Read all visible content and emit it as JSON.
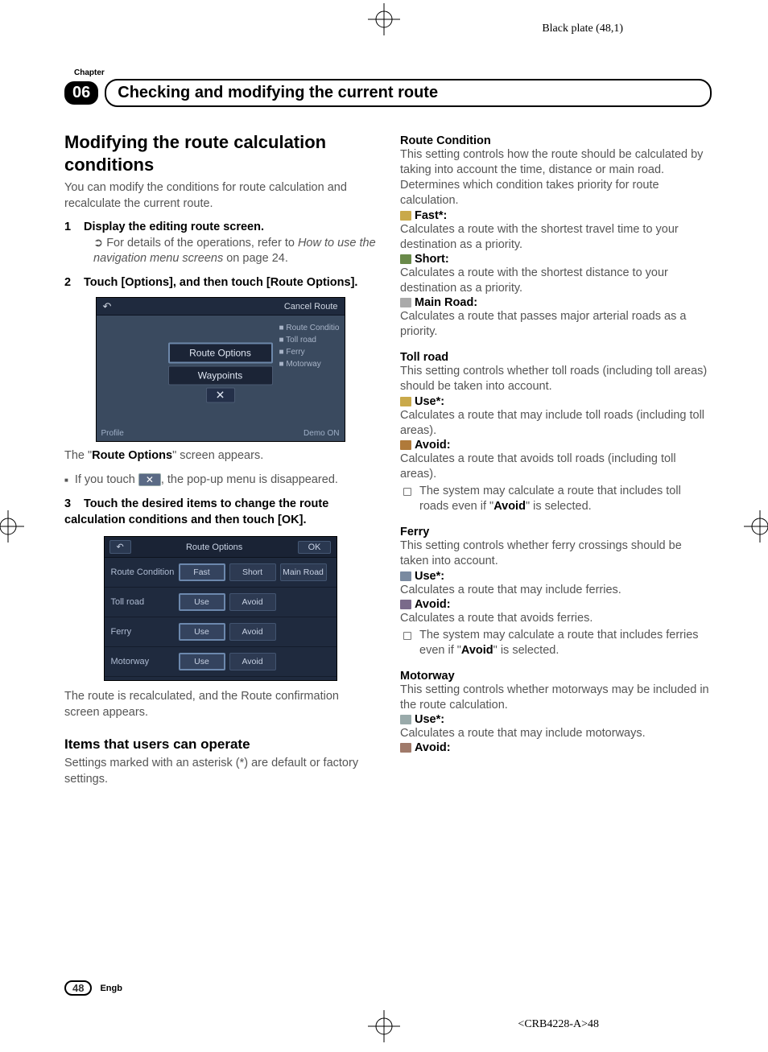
{
  "meta": {
    "black_plate": "Black plate (48,1)",
    "chapter_label": "Chapter",
    "chapter_number": "06",
    "header_title": "Checking and modifying the current route",
    "page_number": "48",
    "lang": "Engb",
    "doc_code": "<CRB4228-A>48"
  },
  "left": {
    "h1": "Modifying the route calculation conditions",
    "intro": "You can modify the conditions for route calculation and recalculate the current route.",
    "step1_num": "1",
    "step1": "Display the editing route screen.",
    "step1_note_pre": "For details of the operations, refer to ",
    "step1_note_ital": "How to use the navigation menu screens",
    "step1_note_post": " on page 24.",
    "step2_num": "2",
    "step2": "Touch [Options], and then touch [Route Options].",
    "shot1": {
      "cancel": "Cancel Route",
      "r1": "Route Conditio",
      "r2": "Toll road",
      "r3": "Ferry",
      "r4": "Motorway",
      "btn1": "Route Options",
      "btn2": "Waypoints",
      "profile": "Profile",
      "demo": "Demo ON"
    },
    "after_shot1_a": "The \"",
    "after_shot1_b": "Route Options",
    "after_shot1_c": "\" screen appears.",
    "bullet_pre": "If you touch ",
    "bullet_post": ", the pop-up menu is disappeared.",
    "step3_num": "3",
    "step3": "Touch the desired items to change the route calculation conditions and then touch [OK].",
    "shot2": {
      "title": "Route Options",
      "ok": "OK",
      "rows": [
        {
          "label": "Route Condition",
          "opts": [
            "Fast",
            "Short",
            "Main Road"
          ],
          "sel": 0
        },
        {
          "label": "Toll road",
          "opts": [
            "Use",
            "Avoid"
          ],
          "sel": 0
        },
        {
          "label": "Ferry",
          "opts": [
            "Use",
            "Avoid"
          ],
          "sel": 0
        },
        {
          "label": "Motorway",
          "opts": [
            "Use",
            "Avoid"
          ],
          "sel": 0
        }
      ]
    },
    "after_shot2": "The route is recalculated, and the Route confirmation screen appears.",
    "h2": "Items that users can operate",
    "h2_body": "Settings marked with an asterisk (*) are default or factory settings."
  },
  "right": {
    "rc_heading": "Route Condition",
    "rc_body1": "This setting controls how the route should be calculated by taking into account the time, distance or main road.",
    "rc_body2": "Determines which condition takes priority for route calculation.",
    "rc_fast": "Fast*:",
    "rc_fast_d": "Calculates a route with the shortest travel time to your destination as a priority.",
    "rc_short": "Short:",
    "rc_short_d": "Calculates a route with the shortest distance to your destination as a priority.",
    "rc_main": "Main Road:",
    "rc_main_d": "Calculates a route that passes major arterial roads as a priority.",
    "toll_heading": "Toll road",
    "toll_body": "This setting controls whether toll roads (including toll areas) should be taken into account.",
    "toll_use": "Use*:",
    "toll_use_d": "Calculates a route that may include toll roads (including toll areas).",
    "toll_avoid": "Avoid:",
    "toll_avoid_d": "Calculates a route that avoids toll roads (including toll areas).",
    "toll_note_a": "The system may calculate a route that includes toll roads even if \"",
    "toll_note_b": "Avoid",
    "toll_note_c": "\" is selected.",
    "ferry_heading": "Ferry",
    "ferry_body": "This setting controls whether ferry crossings should be taken into account.",
    "ferry_use": "Use*:",
    "ferry_use_d": "Calculates a route that may include ferries.",
    "ferry_avoid": "Avoid:",
    "ferry_avoid_d": "Calculates a route that avoids ferries.",
    "ferry_note_a": "The system may calculate a route that includes ferries even if \"",
    "ferry_note_b": "Avoid",
    "ferry_note_c": "\" is selected.",
    "motor_heading": "Motorway",
    "motor_body": "This setting controls whether motorways may be included in the route calculation.",
    "motor_use": "Use*:",
    "motor_use_d": "Calculates a route that may include motorways.",
    "motor_avoid": "Avoid:"
  }
}
